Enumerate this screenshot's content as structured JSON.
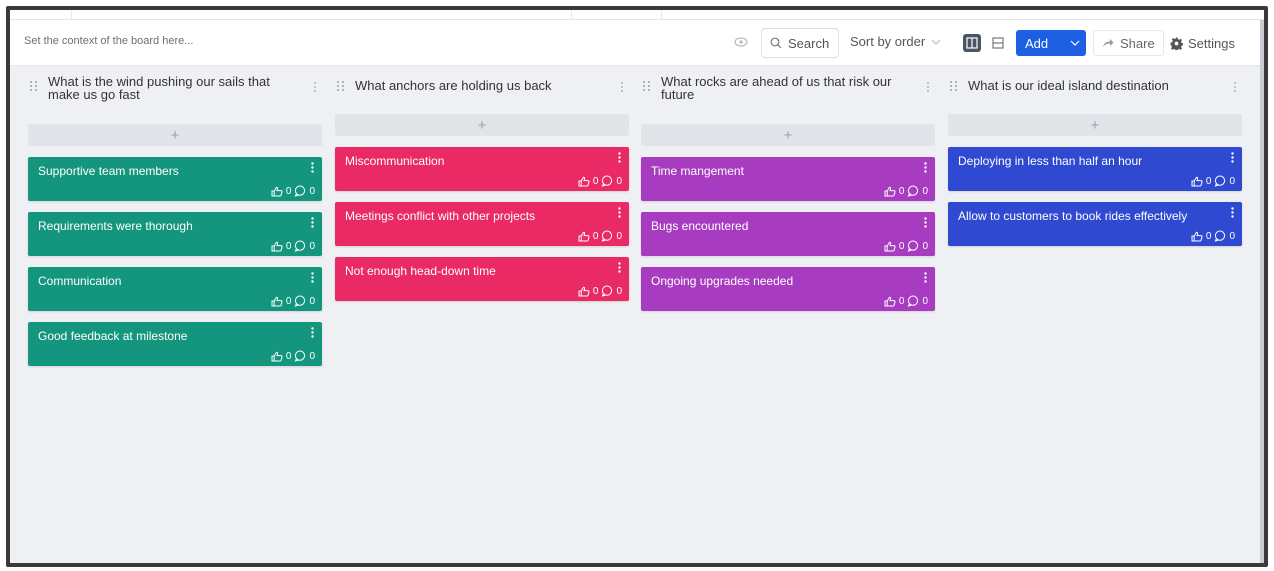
{
  "toolbar": {
    "context_placeholder": "Set the context of the board here...",
    "search_label": "Search",
    "sort_label": "Sort by order",
    "add_label": "Add",
    "share_label": "Share",
    "settings_label": "Settings"
  },
  "columns": [
    {
      "title": "What is the wind pushing our sails that make us go fast",
      "color": "#14967e",
      "cards": [
        {
          "text": "Supportive team members",
          "likes": "0",
          "comments": "0"
        },
        {
          "text": "Requirements were thorough",
          "likes": "0",
          "comments": "0"
        },
        {
          "text": "Communication",
          "likes": "0",
          "comments": "0"
        },
        {
          "text": "Good feedback at milestone",
          "likes": "0",
          "comments": "0"
        }
      ]
    },
    {
      "title": "What anchors are holding us back",
      "color": "#e92a64",
      "cards": [
        {
          "text": "Miscommunication",
          "likes": "0",
          "comments": "0"
        },
        {
          "text": "Meetings conflict with other projects",
          "likes": "0",
          "comments": "0"
        },
        {
          "text": "Not enough head-down time",
          "likes": "0",
          "comments": "0"
        }
      ]
    },
    {
      "title": "What rocks are ahead of us that risk our future",
      "color": "#a83cc0",
      "cards": [
        {
          "text": "Time mangement",
          "likes": "0",
          "comments": "0"
        },
        {
          "text": "Bugs encountered",
          "likes": "0",
          "comments": "0"
        },
        {
          "text": "Ongoing upgrades needed",
          "likes": "0",
          "comments": "0"
        }
      ]
    },
    {
      "title": "What is our ideal island destination",
      "color": "#2f49d1",
      "cards": [
        {
          "text": "Deploying in less than half an hour",
          "likes": "0",
          "comments": "0"
        },
        {
          "text": "Allow to customers to book rides effectively",
          "likes": "0",
          "comments": "0"
        }
      ]
    }
  ],
  "icons": {
    "drag": "drag-handle-icon",
    "menu": "kebab-menu-icon",
    "like": "thumbs-up-icon",
    "comment": "comment-icon"
  }
}
